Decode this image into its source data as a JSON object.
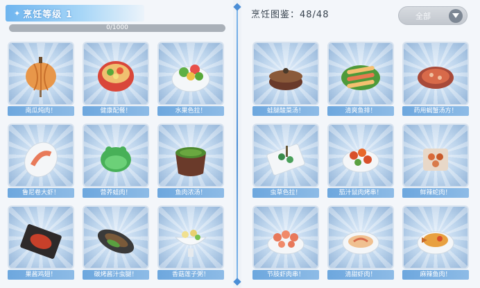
{
  "player": {
    "level_label": "烹饪等级 1",
    "exp_text": "0/1000",
    "exp_progress": 0.0
  },
  "collection": {
    "title": "烹饪图鉴：48/48",
    "filter_label": "全部"
  },
  "left_dishes": [
    {
      "name": "南瓜炖肉！",
      "icon": "pumpkin-stew-icon"
    },
    {
      "name": "健康配餐！",
      "icon": "healthy-meal-icon"
    },
    {
      "name": "水果色拉！",
      "icon": "fruit-salad-icon"
    },
    {
      "name": "鲁尼卷大虾！",
      "icon": "shrimp-roll-icon"
    },
    {
      "name": "营养蛙肉！",
      "icon": "frog-meat-icon"
    },
    {
      "name": "鱼肉浓汤！",
      "icon": "fish-soup-icon"
    },
    {
      "name": "果酱鸡翅！",
      "icon": "jam-wings-icon"
    },
    {
      "name": "碳烤酱汁虫腿！",
      "icon": "grilled-bug-leg-icon"
    },
    {
      "name": "香菇莲子粥！",
      "icon": "mushroom-porridge-icon"
    }
  ],
  "right_dishes": [
    {
      "name": "蛙腿酸菜汤！",
      "icon": "frog-leg-soup-icon"
    },
    {
      "name": "清爽鱼排！",
      "icon": "fish-fillet-icon"
    },
    {
      "name": "药用蝎蟹汤方！",
      "icon": "medicinal-soup-icon"
    },
    {
      "name": "虫草色拉！",
      "icon": "cordyceps-salad-icon"
    },
    {
      "name": "茄汁鼠肉烤串！",
      "icon": "tomato-skewer-icon"
    },
    {
      "name": "鲜辣蛇肉！",
      "icon": "spicy-snake-icon"
    },
    {
      "name": "节肢虾肉串！",
      "icon": "shrimp-skewer-icon"
    },
    {
      "name": "清甜虾肉！",
      "icon": "sweet-shrimp-icon"
    },
    {
      "name": "麻辣鱼肉！",
      "icon": "spicy-fish-icon"
    }
  ],
  "colors": {
    "accent": "#5aa3e6",
    "name_bar": "#7ab0e2",
    "card_border": "#d8e3ef"
  }
}
